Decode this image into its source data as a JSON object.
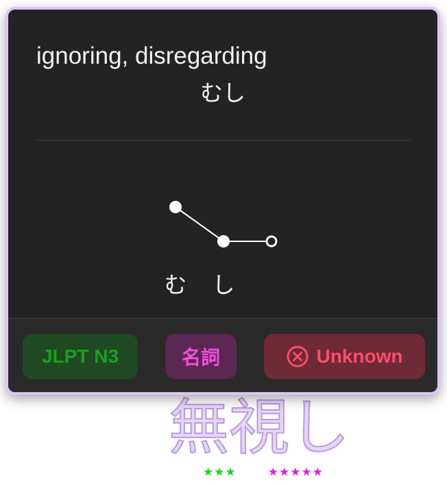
{
  "popup": {
    "definition": "ignoring, disregarding",
    "reading": "むし",
    "pitch": {
      "morae": [
        "む",
        "し"
      ],
      "pattern": [
        "high",
        "low",
        "low-particle"
      ]
    },
    "tags": {
      "jlpt": "JLPT N3",
      "part_of_speech": "名詞",
      "status": "Unknown"
    }
  },
  "background_word": {
    "text": "無視し",
    "stars_a": "★★★",
    "stars_b": "★★★★★"
  },
  "colors": {
    "card_bg": "#232323",
    "card_border": "#dcc6f6",
    "jlpt": "#14a41d",
    "pos": "#f24ee0",
    "status": "#ff4d67"
  }
}
